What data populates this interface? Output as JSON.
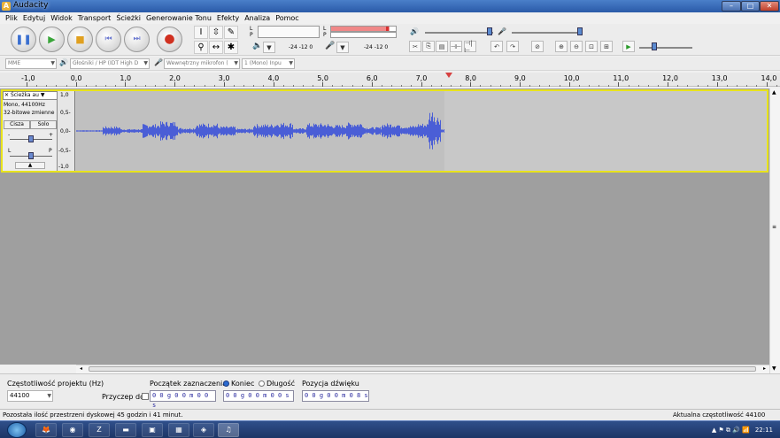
{
  "window": {
    "title": "Audacity",
    "min": "–",
    "max": "□",
    "close": "✕"
  },
  "menu": [
    "Plik",
    "Edytuj",
    "Widok",
    "Transport",
    "Ścieżki",
    "Generowanie Tonu",
    "Efekty",
    "Analiza",
    "Pomoc"
  ],
  "transport": {
    "pause": "❚❚",
    "play": "▶",
    "stop": "■",
    "skip_start": "⏮",
    "skip_end": "⏭",
    "record": "●"
  },
  "tools": {
    "select": "I",
    "envelope": "⇳",
    "draw": "✎",
    "zoom": "⚲",
    "timeshift": "↔",
    "multi": "✱"
  },
  "meters": {
    "play_label": "L R",
    "rec_label": "L R",
    "scale_play": "-24  -12  0",
    "scale_rec": "-24  -12  0"
  },
  "edit_tools": {
    "cut": "✂",
    "copy": "⎘",
    "paste": "📋",
    "trim": "⊣⊢",
    "silence": "⊣|⊢",
    "undo": "↶",
    "redo": "↷",
    "sync": "⊘",
    "zoom_in": "⊕",
    "zoom_out": "⊖",
    "fit_sel": "⊡",
    "fit_proj": "⊞",
    "play_at_speed": "▶"
  },
  "devices": {
    "host": "MME",
    "output": "Głośniki / HP (IDT High D",
    "input": "Wewnętrzny mikrofon (",
    "channels": "1 (Mono) Inpu"
  },
  "ruler": {
    "ticks": [
      "-1,0",
      "0,0",
      "1,0",
      "2,0",
      "3,0",
      "4,0",
      "5,0",
      "6,0",
      "7,0",
      "8,0",
      "9,0",
      "10,0",
      "11,0",
      "12,0",
      "13,0",
      "14,0"
    ]
  },
  "track": {
    "name": "Ścieżka au",
    "rate": "Mono, 44100Hz",
    "format": "32-bitowe zmienne",
    "mute": "Cisza",
    "solo": "Solo",
    "gain_l": "-",
    "gain_r": "+",
    "pan_l": "L",
    "pan_r": "P",
    "scale": [
      "1,0",
      "0,5-",
      "0,0-",
      "-0,5-",
      "-1,0"
    ]
  },
  "selection": {
    "rate_label": "Częstotliwość projektu (Hz)",
    "rate_value": "44100",
    "snap_label": "Przyczep do",
    "start_label": "Początek zaznaczenia:",
    "end_radio": "Koniec",
    "length_radio": "Długość",
    "audio_pos_label": "Pozycja dźwięku",
    "start_value": "0 0 g 0 0 m 0 0 s",
    "end_value": "0 0 g 0 0 m 0 0 s",
    "pos_value": "0 0 g 0 0 m 0 8 s"
  },
  "status": {
    "left": "Pozostała ilość przestrzeni dyskowej 45 godzin i 41 minut.",
    "right": "Aktualna częstotliwość 44100"
  },
  "taskbar": {
    "clock": "22:11",
    "tray_icons": "▲  ⚑  ⧉  🔊  📶"
  },
  "colors": {
    "waveform": "#4a5ed6",
    "selection_border": "#e8e31c",
    "playhead": "#d64040"
  }
}
